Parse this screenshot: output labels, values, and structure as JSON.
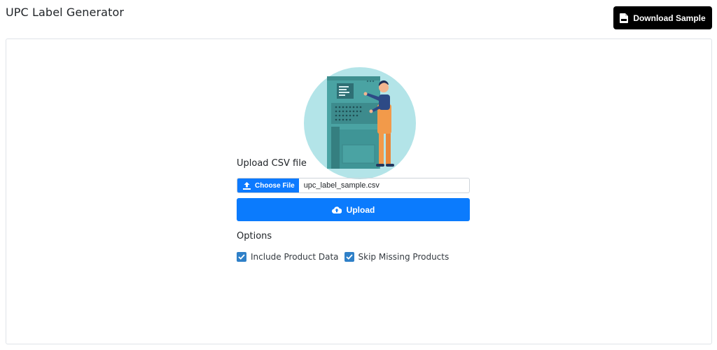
{
  "header": {
    "title": "UPC Label Generator",
    "download_label": "Download Sample",
    "download_icon": "csv-file-icon"
  },
  "upload": {
    "section_label": "Upload CSV file",
    "choose_file_label": "Choose File",
    "file_name": "upc_label_sample.csv",
    "upload_button_label": "Upload",
    "upload_icon": "cloud-upload-icon"
  },
  "options": {
    "label": "Options",
    "items": [
      {
        "label": "Include Product Data",
        "checked": true
      },
      {
        "label": "Skip Missing Products",
        "checked": true
      }
    ]
  },
  "colors": {
    "primary": "#0b7bfd",
    "checkbox": "#2f80c8",
    "dark_button": "#000000",
    "illustration_circle": "#b3e4e8"
  }
}
